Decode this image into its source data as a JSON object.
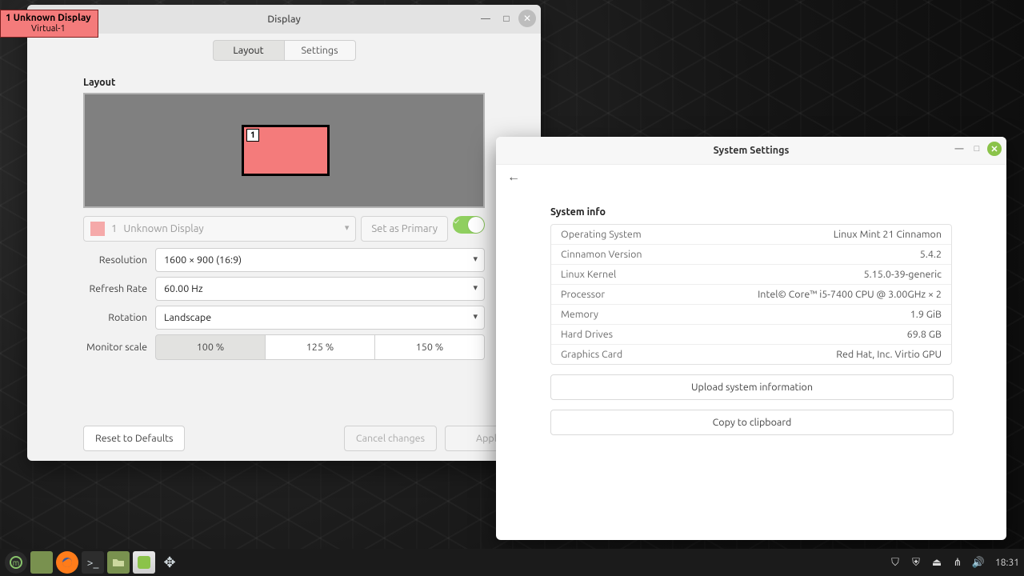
{
  "overlay_badge": {
    "line1": "1  Unknown Display",
    "line2": "Virtual-1"
  },
  "display_window": {
    "title": "Display",
    "tabs": {
      "layout": "Layout",
      "settings": "Settings"
    },
    "section_label": "Layout",
    "monitor_index": "1",
    "display_selector": {
      "index": "1",
      "name": "Unknown Display"
    },
    "set_primary_label": "Set as Primary",
    "resolution": {
      "label": "Resolution",
      "value": "1600 × 900 (16:9)"
    },
    "refresh": {
      "label": "Refresh Rate",
      "value": "60.00 Hz"
    },
    "rotation": {
      "label": "Rotation",
      "value": "Landscape"
    },
    "scale": {
      "label": "Monitor scale",
      "options": [
        "100 %",
        "125 %",
        "150 %"
      ],
      "selected": 0
    },
    "buttons": {
      "reset": "Reset to Defaults",
      "cancel": "Cancel changes",
      "apply": "Apply"
    }
  },
  "settings_window": {
    "title": "System Settings",
    "section_label": "System info",
    "rows": [
      {
        "k": "Operating System",
        "v": "Linux Mint 21 Cinnamon"
      },
      {
        "k": "Cinnamon Version",
        "v": "5.4.2"
      },
      {
        "k": "Linux Kernel",
        "v": "5.15.0-39-generic"
      },
      {
        "k": "Processor",
        "v": "Intel© Core™ i5-7400 CPU @ 3.00GHz × 2"
      },
      {
        "k": "Memory",
        "v": "1.9 GiB"
      },
      {
        "k": "Hard Drives",
        "v": "69.8 GB"
      },
      {
        "k": "Graphics Card",
        "v": "Red Hat, Inc. Virtio GPU"
      }
    ],
    "upload_btn": "Upload system information",
    "copy_btn": "Copy to clipboard"
  },
  "taskbar": {
    "clock": "18:31"
  }
}
